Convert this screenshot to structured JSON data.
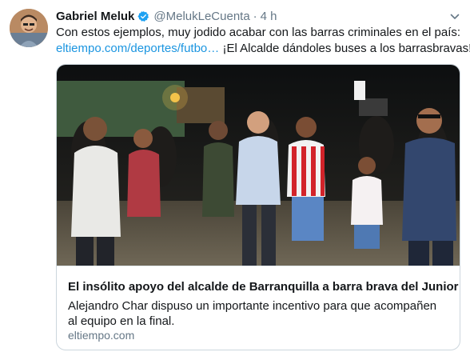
{
  "tweet": {
    "author_name": "Gabriel Meluk",
    "handle": "@MelukLeCuenta",
    "separator": "·",
    "time": "4 h",
    "text_line1": "Con estos ejemplos, muy jodido acabar con las barras criminales en el país:",
    "link_text": "eltiempo.com/deportes/futbo…",
    "text_line2_rest": " ¡El Alcalde dándoles buses a los barrasbravas!"
  },
  "card": {
    "title": "El insólito apoyo del alcalde de Barranquilla a barra brava del Junior",
    "description": "Alejandro Char dispuso un importante incentivo para que acompañen al equipo en la final.",
    "domain": "eltiempo.com"
  },
  "colors": {
    "link": "#1b95e0",
    "muted": "#657786",
    "verified": "#1da1f2"
  },
  "icons": {
    "verified": "verified-badge-icon",
    "menu": "chevron-down-icon"
  }
}
